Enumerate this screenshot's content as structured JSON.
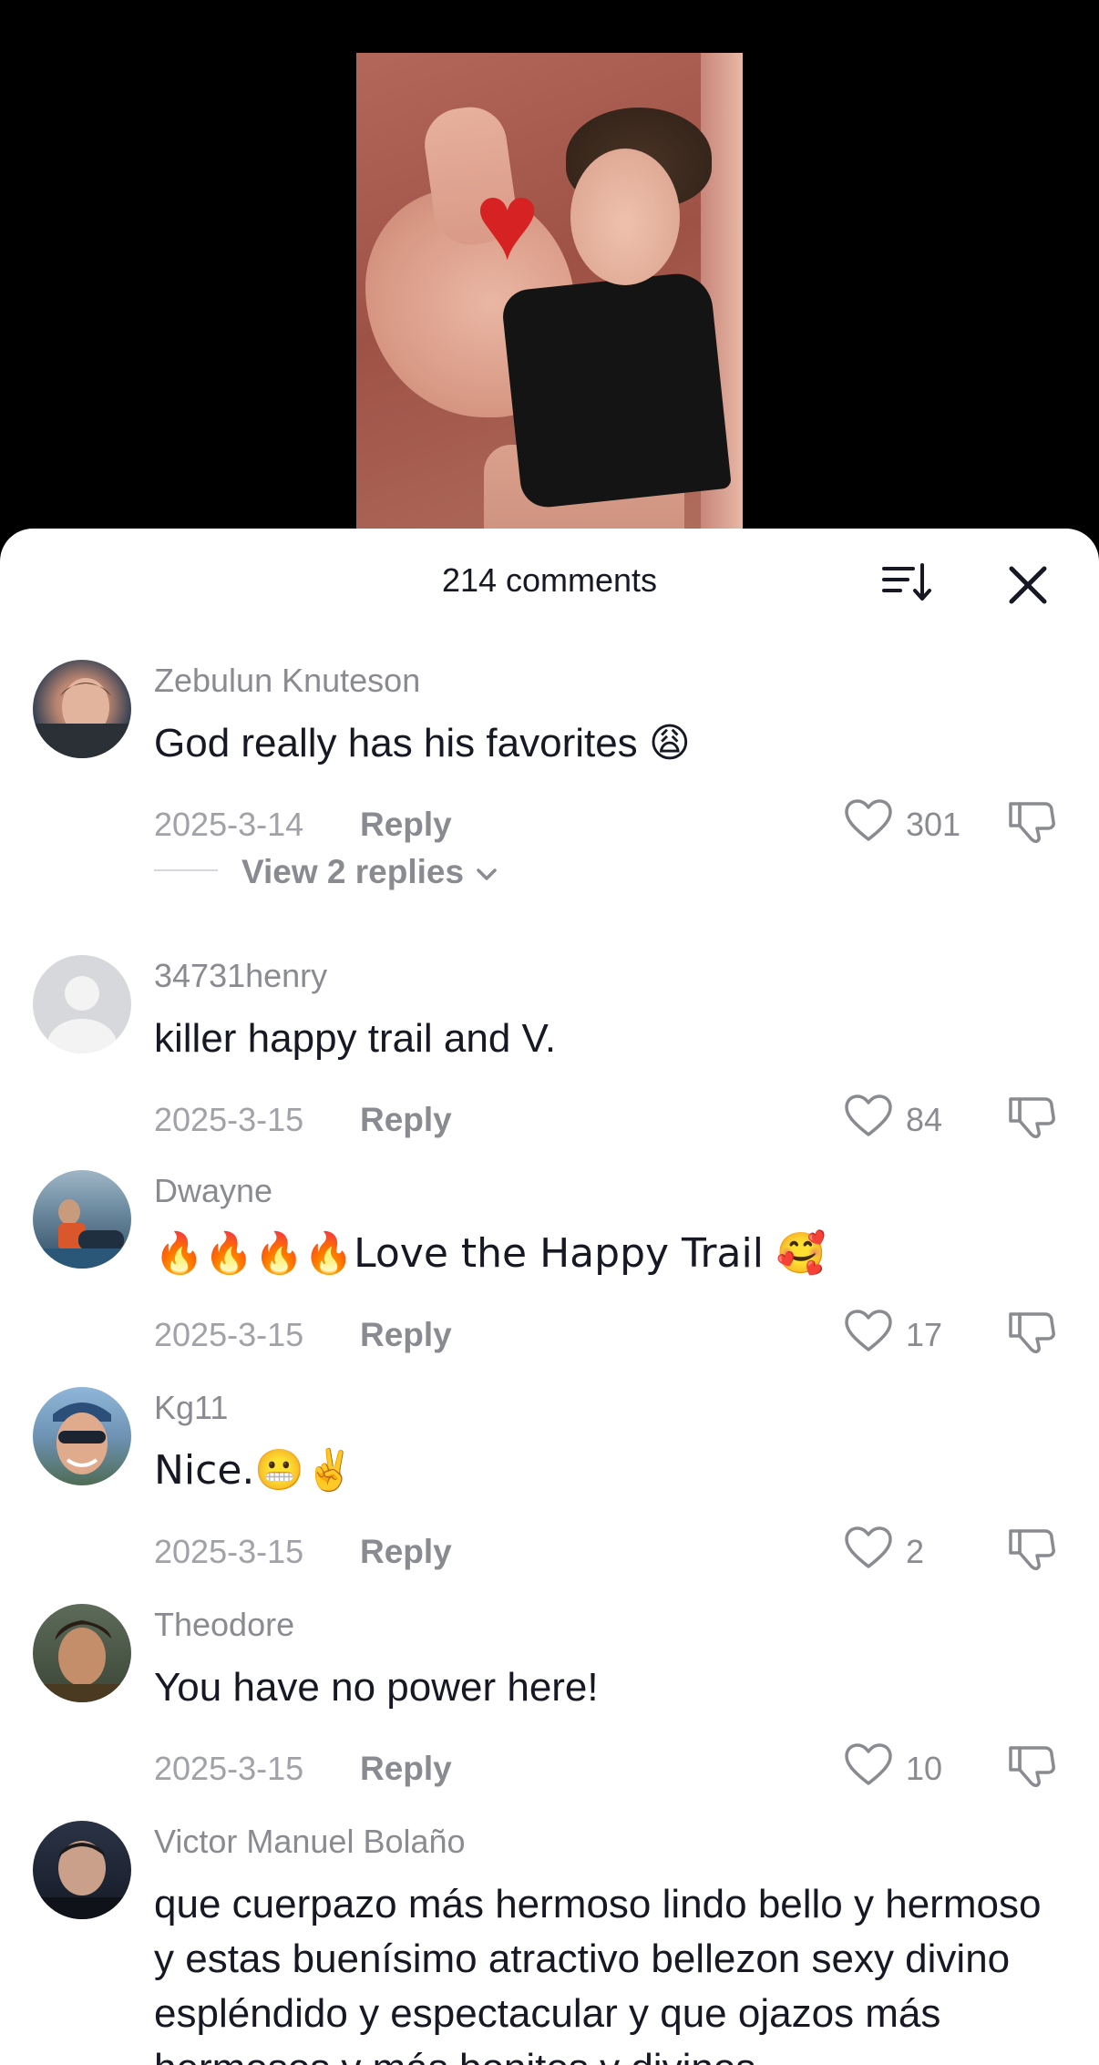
{
  "header": {
    "comments_count": "214 comments"
  },
  "comments": [
    {
      "username": "Zebulun Knuteson",
      "text": "God really has his favorites 😩",
      "date": "2025-3-14",
      "reply_label": "Reply",
      "likes": "301",
      "view_replies": "View 2 replies"
    },
    {
      "username": "34731henry",
      "text": "killer happy trail and V.",
      "date": "2025-3-15",
      "reply_label": "Reply",
      "likes": "84"
    },
    {
      "username": "Dwayne",
      "text": "🔥🔥🔥🔥Love the Happy Trail 🥰",
      "date": "2025-3-15",
      "reply_label": "Reply",
      "likes": "17"
    },
    {
      "username": "Kg11",
      "text": "Nice.😬✌️",
      "date": "2025-3-15",
      "reply_label": "Reply",
      "likes": "2"
    },
    {
      "username": "Theodore",
      "text": "You have no power here!",
      "date": "2025-3-15",
      "reply_label": "Reply",
      "likes": "10"
    },
    {
      "username": "Victor Manuel Bolaño",
      "text": "que cuerpazo más hermoso lindo bello y hermoso y estas buenísimo atractivo bellezon sexy divino espléndido y espectacular y que ojazos más hermosos y más bonitos y divinos"
    }
  ],
  "colors": {
    "text_primary": "#161823",
    "text_secondary": "#8a8b91",
    "sheet_background": "#ffffff",
    "backdrop": "#000000"
  },
  "icons": {
    "sort": "sort-icon",
    "close": "close-icon",
    "like": "heart-icon",
    "dislike": "thumbs-down-icon",
    "chevron": "chevron-down-icon"
  }
}
